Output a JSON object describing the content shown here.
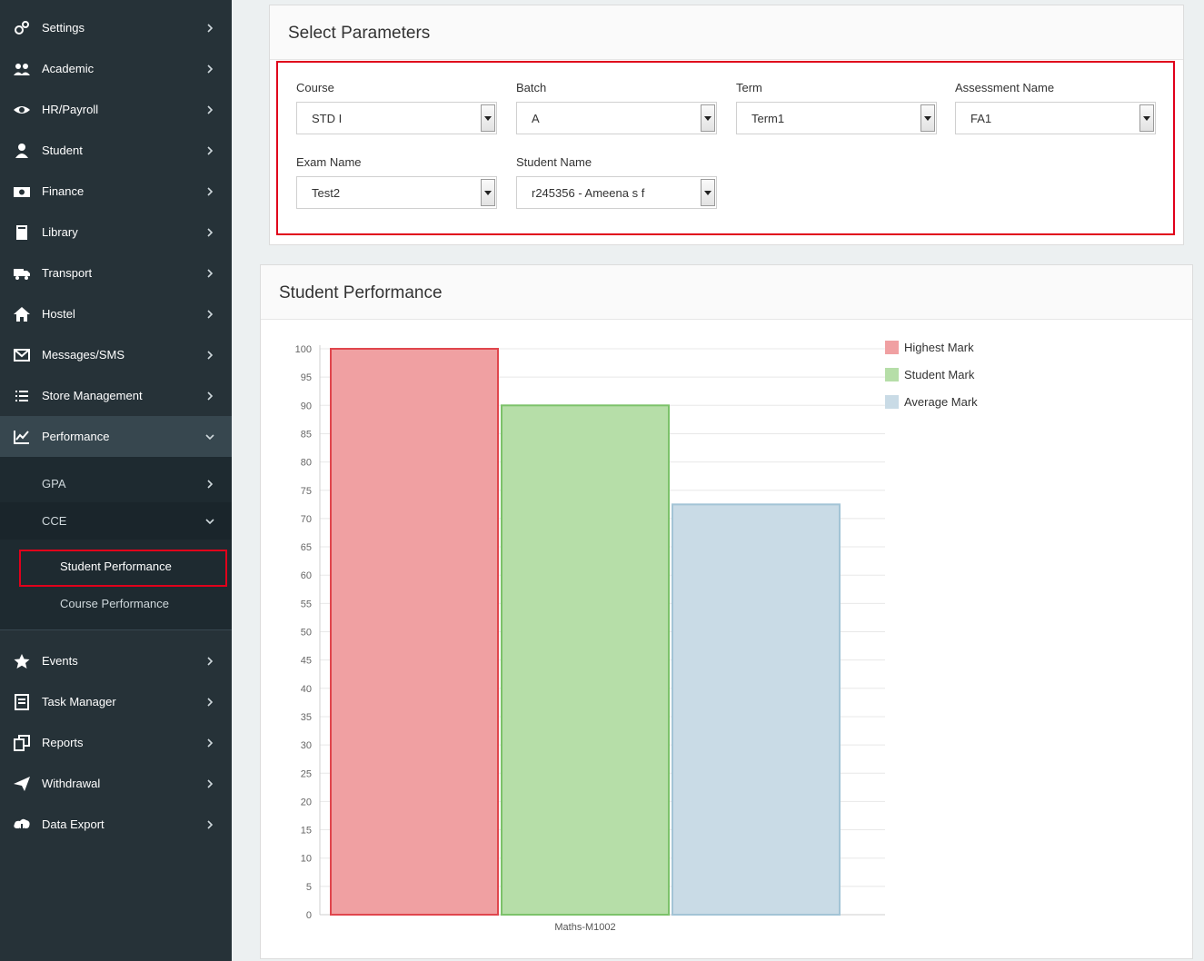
{
  "sidebar": {
    "items": [
      {
        "label": "Settings",
        "icon": "gears-icon"
      },
      {
        "label": "Academic",
        "icon": "users-icon"
      },
      {
        "label": "HR/Payroll",
        "icon": "eye-icon"
      },
      {
        "label": "Student",
        "icon": "user-icon"
      },
      {
        "label": "Finance",
        "icon": "money-icon"
      },
      {
        "label": "Library",
        "icon": "book-icon"
      },
      {
        "label": "Transport",
        "icon": "truck-icon"
      },
      {
        "label": "Hostel",
        "icon": "home-icon"
      },
      {
        "label": "Messages/SMS",
        "icon": "envelope-icon"
      },
      {
        "label": "Store Management",
        "icon": "list-icon"
      },
      {
        "label": "Performance",
        "icon": "line-chart-icon"
      },
      {
        "label": "Events",
        "icon": "star-icon"
      },
      {
        "label": "Task Manager",
        "icon": "document-icon"
      },
      {
        "label": "Reports",
        "icon": "copy-icon"
      },
      {
        "label": "Withdrawal",
        "icon": "paper-plane-icon"
      },
      {
        "label": "Data Export",
        "icon": "cloud-download-icon"
      }
    ],
    "performance_sub": {
      "gpa": "GPA",
      "cce": "CCE",
      "cce_items": [
        "Student Performance",
        "Course Performance"
      ]
    }
  },
  "params": {
    "title": "Select Parameters",
    "course": {
      "label": "Course",
      "value": "STD I"
    },
    "batch": {
      "label": "Batch",
      "value": "A"
    },
    "term": {
      "label": "Term",
      "value": "Term1"
    },
    "assessment": {
      "label": "Assessment Name",
      "value": "FA1"
    },
    "exam": {
      "label": "Exam Name",
      "value": "Test2"
    },
    "student": {
      "label": "Student Name",
      "value": "r245356 - Ameena s f"
    }
  },
  "performance": {
    "title": "Student Performance"
  },
  "chart_data": {
    "type": "bar",
    "categories": [
      "Maths-M1002"
    ],
    "series": [
      {
        "name": "Highest Mark",
        "values": [
          100
        ],
        "fill": "#f0a0a2",
        "stroke": "#e0464d"
      },
      {
        "name": "Student Mark",
        "values": [
          90
        ],
        "fill": "#b6dea8",
        "stroke": "#7cc26a"
      },
      {
        "name": "Average Mark",
        "values": [
          72.5
        ],
        "fill": "#c9dbe6",
        "stroke": "#a3c4d6"
      }
    ],
    "ylim": [
      0,
      100
    ],
    "ytick_step": 5,
    "legend": "top-right",
    "grid": true
  }
}
